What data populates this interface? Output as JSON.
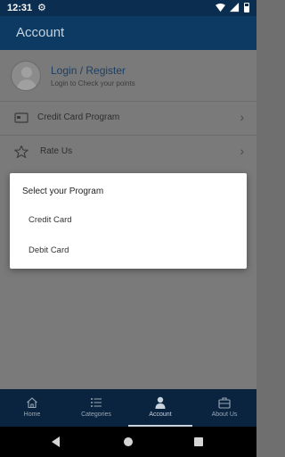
{
  "status_bar": {
    "time": "12:31"
  },
  "app_bar": {
    "title": "Account"
  },
  "profile": {
    "title": "Login / Register",
    "subtitle": "Login to Check your points"
  },
  "menu": [
    {
      "label": "Credit Card Program",
      "icon": "credit-card-icon"
    },
    {
      "label": "Rate Us",
      "icon": "star-icon"
    }
  ],
  "dialog": {
    "title": "Select your Program",
    "options": [
      "Credit Card",
      "Debit Card"
    ]
  },
  "bottom_nav": {
    "items": [
      {
        "label": "Home",
        "icon": "home-icon"
      },
      {
        "label": "Categories",
        "icon": "list-icon"
      },
      {
        "label": "Account",
        "icon": "person-icon",
        "active": true
      },
      {
        "label": "About Us",
        "icon": "briefcase-icon"
      }
    ]
  },
  "colors": {
    "app_bar": "#0d3a63",
    "bottom_nav": "#0a2440",
    "link": "#1c3f63"
  }
}
